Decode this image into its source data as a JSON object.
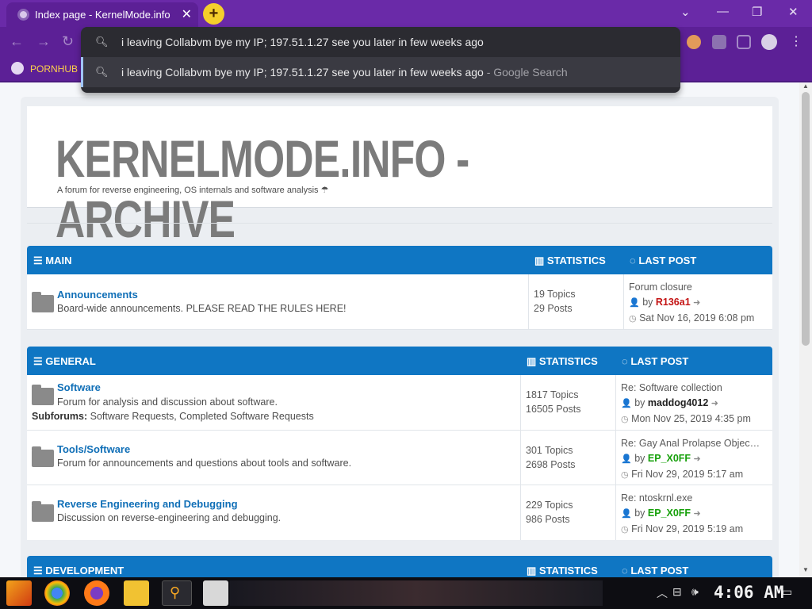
{
  "browser": {
    "tab_title": "Index page - KernelMode.info",
    "tab_close": "✕",
    "new_tab": "+",
    "window_controls": [
      "⌄",
      "—",
      "❐",
      "✕"
    ],
    "omnibox_text": "i leaving Collabvm bye my IP; 197.51.1.27 see you later in few weeks ago",
    "suggestion_text": "i leaving Collabvm bye my IP; 197.51.1.27 see you later in few weeks ago",
    "suggestion_hint": "- Google Search",
    "bookmark_label": "PORNHUB"
  },
  "site": {
    "logo": "KERNELMODE.INFO - ARCHIVE",
    "tagline": "A forum for reverse engineering, OS internals and software analysis ☂"
  },
  "sections": [
    {
      "name": "MAIN",
      "stats_label": "STATISTICS",
      "last_label": "LAST POST",
      "rows": [
        {
          "title": "Announcements",
          "desc": "Board-wide announcements. PLEASE READ THE RULES HERE!",
          "topics": "19 Topics",
          "posts": "29 Posts",
          "last_title": "Forum closure",
          "by": "by",
          "user": "R136a1",
          "date": "Sat Nov 16, 2019 6:08 pm"
        }
      ]
    },
    {
      "name": "GENERAL",
      "stats_label": "STATISTICS",
      "last_label": "LAST POST",
      "rows": [
        {
          "title": "Software",
          "desc": "Forum for analysis and discussion about software.",
          "subforums_label": "Subforums:",
          "subforums": "Software Requests, Completed Software Requests",
          "topics": "1817 Topics",
          "posts": "16505 Posts",
          "last_title": "Re: Software collection",
          "by": "by",
          "user": "maddog4012",
          "date": "Mon Nov 25, 2019 4:35 pm"
        },
        {
          "title": "Tools/Software",
          "desc": "Forum for announcements and questions about tools and software.",
          "topics": "301 Topics",
          "posts": "2698 Posts",
          "last_title": "Re: Gay Anal Prolapse Objec…",
          "by": "by",
          "user": "EP_X0FF",
          "date": "Fri Nov 29, 2019 5:17 am"
        },
        {
          "title": "Reverse Engineering and Debugging",
          "desc": "Discussion on reverse-engineering and debugging.",
          "topics": "229 Topics",
          "posts": "986 Posts",
          "last_title": "Re: ntoskrnl.exe",
          "by": "by",
          "user": "EP_X0FF",
          "date": "Fri Nov 29, 2019 5:19 am"
        }
      ]
    },
    {
      "name": "DEVELOPMENT",
      "stats_label": "STATISTICS",
      "last_label": "LAST POST"
    }
  ],
  "taskbar": {
    "clock": "4:06 AM",
    "apps": [
      "start-icon",
      "chrome-icon",
      "firefox-icon",
      "explorer-icon",
      "search-icon",
      "calculator-icon"
    ]
  },
  "colors": {
    "browser_purple": "#5c2096",
    "forum_blue": "#0f76c3",
    "link_blue": "#106fb7",
    "user_red": "#c41414",
    "user_green": "#16a00a"
  }
}
